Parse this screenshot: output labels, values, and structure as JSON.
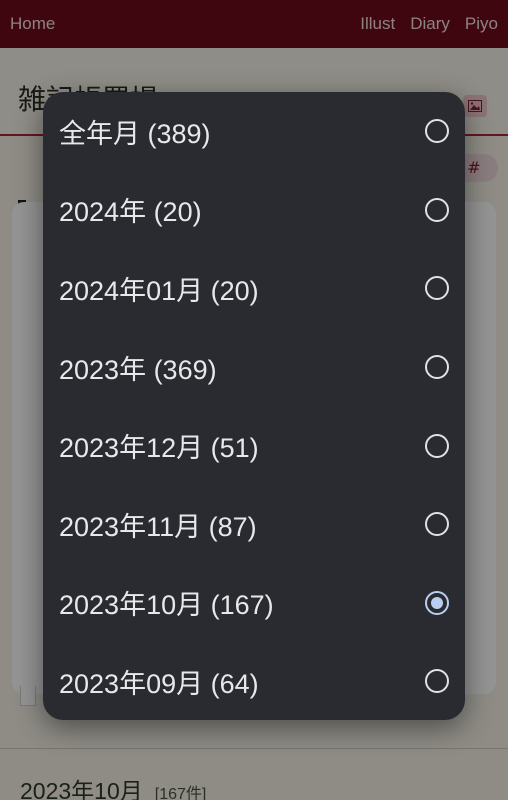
{
  "nav": {
    "home": "Home",
    "links": [
      "Illust",
      "Diary",
      "Piyo"
    ]
  },
  "header": {
    "site_title": "雑記帳置場"
  },
  "chip": {
    "hash": "#"
  },
  "main": {
    "month_heading": "2023年10月",
    "month_count": "[167件]"
  },
  "picker": {
    "options": [
      {
        "label": "全年月 (389)",
        "selected": false
      },
      {
        "label": "2024年 (20)",
        "selected": false
      },
      {
        "label": "2024年01月 (20)",
        "selected": false
      },
      {
        "label": "2023年 (369)",
        "selected": false
      },
      {
        "label": "2023年12月 (51)",
        "selected": false
      },
      {
        "label": "2023年11月 (87)",
        "selected": false
      },
      {
        "label": "2023年10月 (167)",
        "selected": true
      },
      {
        "label": "2023年09月 (64)",
        "selected": false
      }
    ]
  },
  "colors": {
    "topbar": "#6e0c1c",
    "accent": "#b2243a",
    "dialog_bg": "#2a2b31",
    "radio_selected": "#b9cef0"
  }
}
